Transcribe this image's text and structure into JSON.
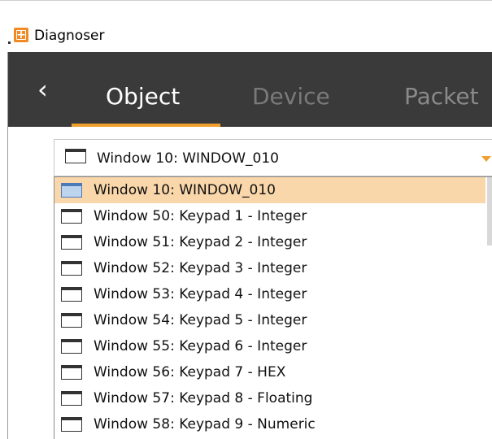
{
  "window": {
    "title": "Diagnoser",
    "icon": "app-icon"
  },
  "nav": {
    "back_icon": "chevron-left-icon",
    "back_glyph": "‹",
    "tabs": [
      {
        "label": "Object",
        "active": true
      },
      {
        "label": "Device",
        "active": false
      },
      {
        "label": "Packet",
        "active": false
      }
    ],
    "accent_color": "#f0a030",
    "background": "#3a3a3a"
  },
  "combo": {
    "selected": "Window 10: WINDOW_010",
    "icon": "window-icon",
    "arrow_icon": "dropdown-arrow-icon"
  },
  "list": {
    "items": [
      {
        "label": "Window 10: WINDOW_010",
        "selected": true
      },
      {
        "label": "Window 50: Keypad 1 - Integer",
        "selected": false
      },
      {
        "label": "Window 51: Keypad 2 - Integer",
        "selected": false
      },
      {
        "label": "Window 52: Keypad 3 - Integer",
        "selected": false
      },
      {
        "label": "Window 53: Keypad 4 - Integer",
        "selected": false
      },
      {
        "label": "Window 54: Keypad 5 - Integer",
        "selected": false
      },
      {
        "label": "Window 55: Keypad 6 - Integer",
        "selected": false
      },
      {
        "label": "Window 56: Keypad 7 - HEX",
        "selected": false
      },
      {
        "label": "Window 57: Keypad 8 - Floating",
        "selected": false
      },
      {
        "label": "Window 58: Keypad 9 - Numeric",
        "selected": false
      }
    ],
    "selected_color": "#fad7aa"
  }
}
